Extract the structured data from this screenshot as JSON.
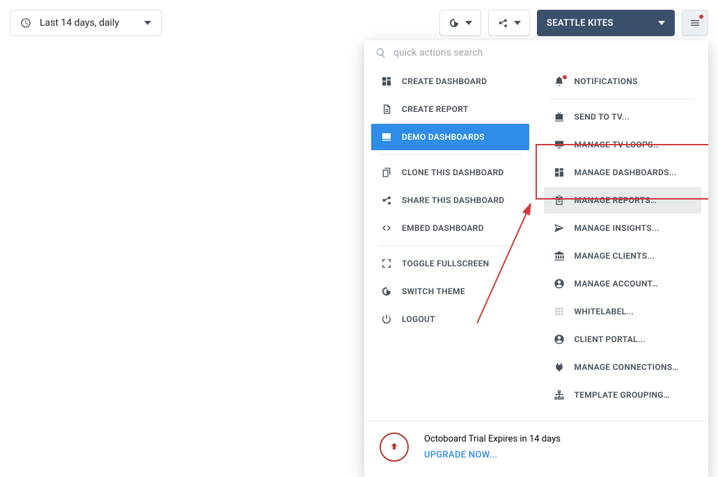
{
  "topbar": {
    "date_label": "Last 14 days, daily",
    "client_name": "SEATTLE KITES"
  },
  "search": {
    "placeholder": "quick actions search"
  },
  "left_menu": {
    "create_dashboard": "CREATE DASHBOARD",
    "create_report": "CREATE REPORT",
    "demo_dashboards": "DEMO DASHBOARDS",
    "clone_dashboard": "CLONE THIS DASHBOARD",
    "share_dashboard": "SHARE THIS DASHBOARD",
    "embed_dashboard": "EMBED DASHBOARD",
    "toggle_fullscreen": "TOGGLE FULLSCREEN",
    "switch_theme": "SWITCH THEME",
    "logout": "LOGOUT"
  },
  "right_menu": {
    "notifications": "NOTIFICATIONS",
    "send_to_tv": "SEND TO TV...",
    "manage_tv_loops": "MANAGE TV LOOPS…",
    "manage_dashboards": "MANAGE DASHBOARDS...",
    "manage_reports": "MANAGE REPORTS…",
    "manage_insights": "MANAGE INSIGHTS...",
    "manage_clients": "MANAGE CLIENTS...",
    "manage_account": "MANAGE ACCOUNT…",
    "whitelabel": "WHITELABEL...",
    "client_portal": "CLIENT PORTAL...",
    "manage_connections": "MANAGE CONNECTIONS…",
    "template_grouping": "TEMPLATE GROUPING…"
  },
  "trial": {
    "message": "Octoboard Trial Expires in 14 days",
    "upgrade": "UPGRADE NOW..."
  }
}
